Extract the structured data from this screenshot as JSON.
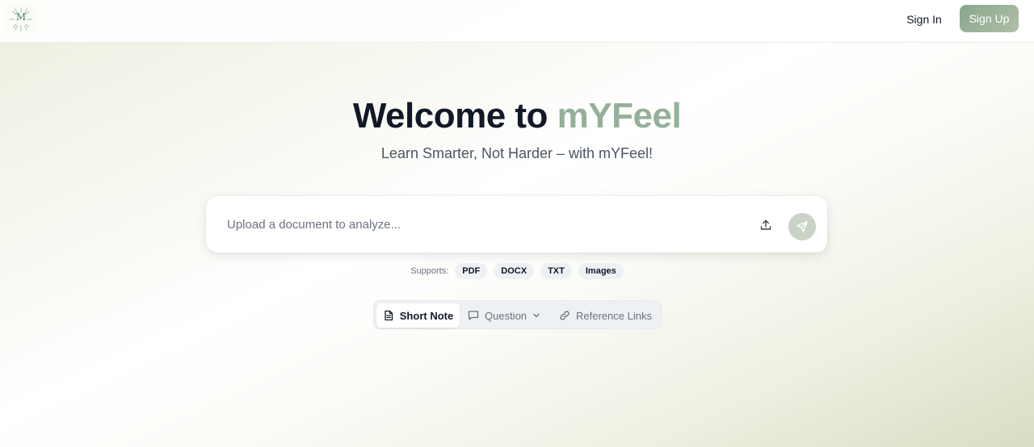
{
  "header": {
    "logo_letter": "M",
    "signin_label": "Sign In",
    "signup_label": "Sign Up"
  },
  "hero": {
    "title_prefix": "Welcome to ",
    "title_brand": "mYFeel",
    "subtitle": "Learn Smarter, Not Harder – with mYFeel!"
  },
  "upload": {
    "placeholder": "Upload a document to analyze...",
    "value": ""
  },
  "supports": {
    "label": "Supports:",
    "formats": [
      "PDF",
      "DOCX",
      "TXT",
      "Images"
    ]
  },
  "tabs": {
    "short_note": "Short Note",
    "question": "Question",
    "reference_links": "Reference Links",
    "active": "Short Note"
  },
  "colors": {
    "brand": "#94b09a",
    "signup_bg": "#9bb39b",
    "send_bg": "#c9d4c6",
    "title": "#111827"
  },
  "icons": {
    "logo": "sunburst-logo-icon",
    "upload": "upload-icon",
    "send": "send-icon",
    "short_note": "document-icon",
    "question": "chat-bubble-icon",
    "dropdown": "chevron-down-icon",
    "reference_links": "link-icon"
  }
}
